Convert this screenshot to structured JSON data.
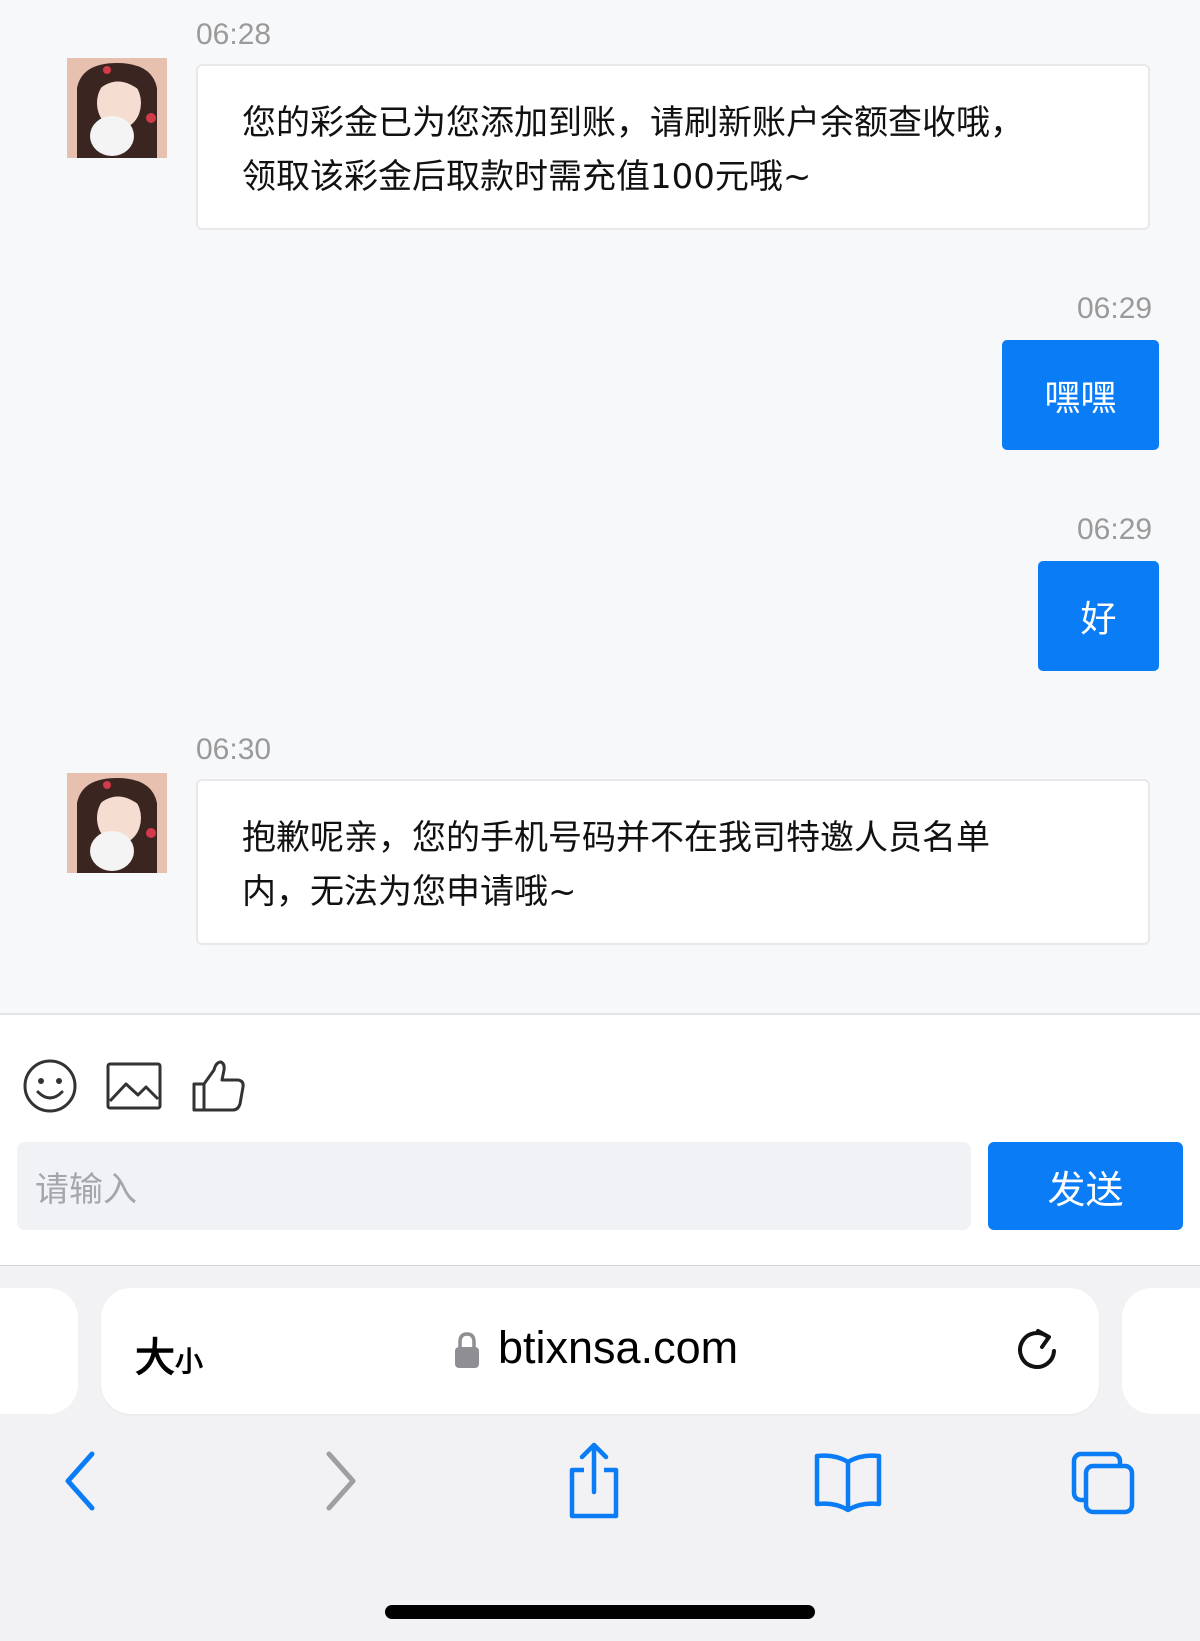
{
  "messages": [
    {
      "time": "06:28",
      "direction": "in",
      "text_line1": "您的彩金已为您添加到账，请刷新账户余额查收哦，",
      "text_line2": "领取该彩金后取款时需充值100元哦~"
    },
    {
      "time": "06:29",
      "direction": "out",
      "text": "嘿嘿"
    },
    {
      "time": "06:29",
      "direction": "out",
      "text": "好"
    },
    {
      "time": "06:30",
      "direction": "in",
      "text_line1": "抱歉呢亲，您的手机号码并不在我司特邀人员名单",
      "text_line2": "内，无法为您申请哦~"
    }
  ],
  "composer": {
    "icons": [
      "emoji-icon",
      "image-icon",
      "thumbs-up-icon"
    ],
    "input_placeholder": "请输入",
    "send_label": "发送"
  },
  "browser": {
    "text_size_large": "大",
    "text_size_small": "小",
    "url": "btixnsa.com",
    "icons": [
      "lock-icon",
      "reload-icon",
      "back-icon",
      "forward-icon",
      "share-icon",
      "bookmarks-icon",
      "tabs-icon"
    ]
  },
  "colors": {
    "accent": "#0a7cf5",
    "background": "#f7f8fa",
    "bubble_in": "#ffffff"
  }
}
